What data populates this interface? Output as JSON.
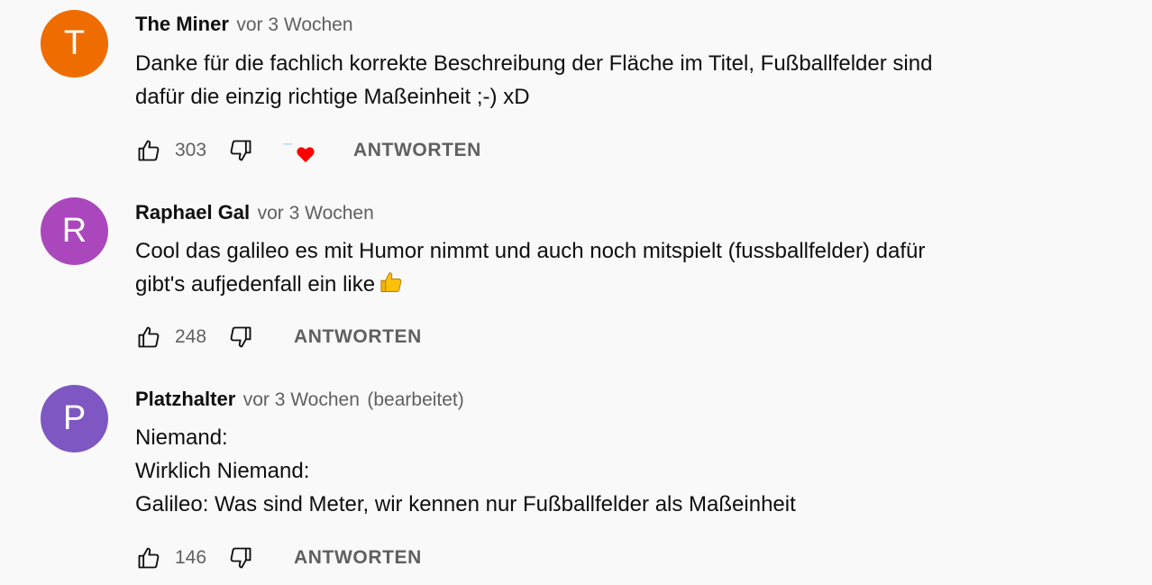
{
  "colors": {
    "avatar_t": "#ef6c00",
    "avatar_r": "#ab47bc",
    "avatar_p": "#7e57c2",
    "heart": "#ff0000",
    "meta_text": "#606060"
  },
  "comments": [
    {
      "avatar_letter": "T",
      "author": "The Miner",
      "time": "vor 3 Wochen",
      "text_lines": [
        "Danke für die fachlich korrekte Beschreibung der Fläche im Titel, Fußballfelder sind",
        "dafür die einzig richtige Maßeinheit ;-) xD"
      ],
      "likes": "303",
      "creator_heart": true,
      "reply_label": "ANTWORTEN"
    },
    {
      "avatar_letter": "R",
      "author": "Raphael Gal",
      "time": "vor 3 Wochen",
      "text_lines": [
        "Cool das galileo es mit Humor nimmt und auch noch mitspielt (fussballfelder) dafür",
        "gibt's aufjedenfall ein like"
      ],
      "emoji": "thumbs-up-emoji",
      "likes": "248",
      "reply_label": "ANTWORTEN"
    },
    {
      "avatar_letter": "P",
      "author": "Platzhalter",
      "time": "vor 3 Wochen",
      "edited": "(bearbeitet)",
      "text_lines": [
        "Niemand:",
        "Wirklich Niemand:",
        "Galileo: Was sind Meter, wir kennen nur Fußballfelder als Maßeinheit"
      ],
      "likes": "146",
      "reply_label": "ANTWORTEN"
    }
  ],
  "icons": {
    "like": "thumb-up-outline-icon",
    "dislike": "thumb-down-outline-icon",
    "heart": "creator-heart-icon"
  }
}
